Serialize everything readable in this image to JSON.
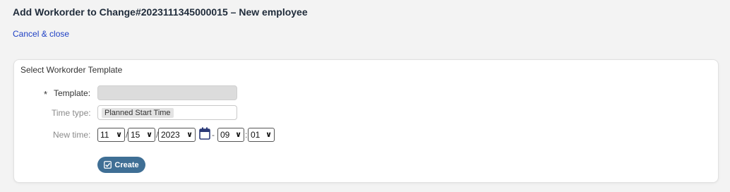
{
  "header": {
    "title": "Add Workorder to Change#2023111345000015 – New employee",
    "cancel_label": "Cancel & close"
  },
  "panel": {
    "title": "Select Workorder Template",
    "template": {
      "label": "Template:",
      "required_mark": "*",
      "value": ""
    },
    "time_type": {
      "label": "Time type:",
      "value": "Planned Start Time"
    },
    "new_time": {
      "label": "New time:",
      "month": "11",
      "day": "15",
      "year": "2023",
      "hour": "09",
      "minute": "01",
      "date_separator": "/",
      "time_separator": "-",
      "hm_separator": ":"
    },
    "create_label": "Create"
  },
  "colors": {
    "link": "#1d3fc4",
    "button": "#3f6f95",
    "background": "#f3f3f3"
  },
  "icons": [
    "calendar-icon",
    "checkbox-check-icon",
    "chevron-down-icon"
  ]
}
